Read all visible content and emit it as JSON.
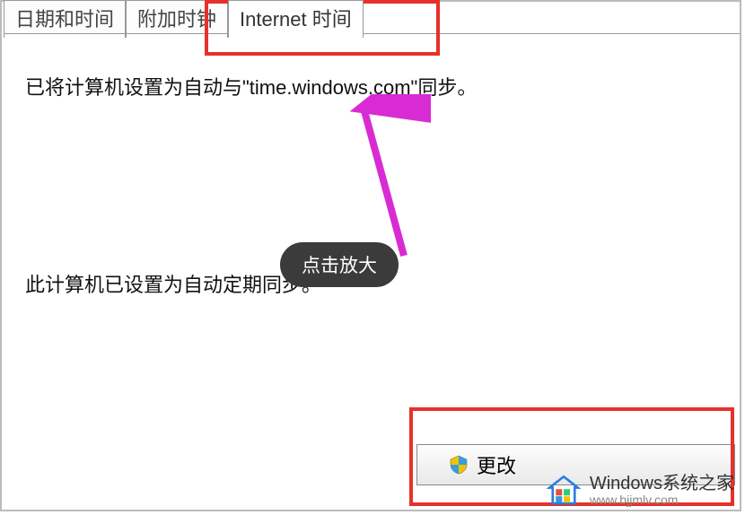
{
  "tabs": {
    "datetime": "日期和时间",
    "additional": "附加时钟",
    "internet": "Internet 时间"
  },
  "body": {
    "sync_text": "已将计算机设置为自动与\"time.windows.com\"同步。",
    "periodic_text": "此计算机已设置为自动定期同步。"
  },
  "tooltip": "点击放大",
  "button": {
    "change_label": "更改"
  },
  "watermark": {
    "title": "Windows系统之家",
    "url": "www.bjjmlv.com"
  }
}
